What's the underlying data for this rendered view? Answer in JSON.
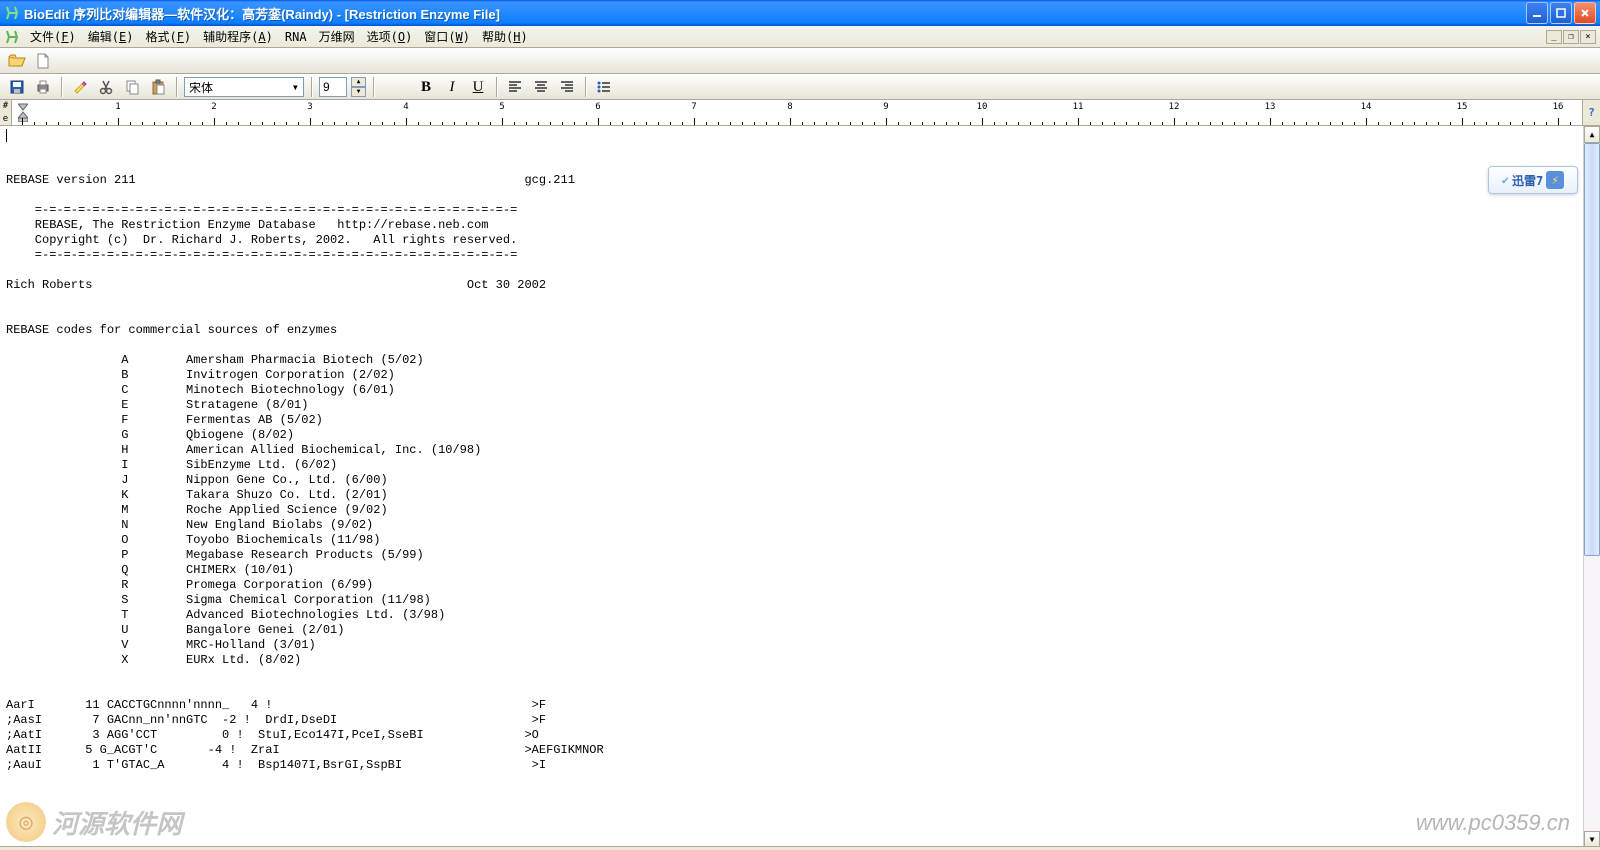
{
  "window": {
    "title": "BioEdit 序列比对编辑器—软件汉化：高芳銮(Raindy) - [Restriction Enzyme File]"
  },
  "menu": {
    "items": [
      {
        "label": "文件",
        "accel": "F"
      },
      {
        "label": "编辑",
        "accel": "E"
      },
      {
        "label": "格式",
        "accel": "F"
      },
      {
        "label": "辅助程序",
        "accel": "A"
      },
      {
        "label": "RNA",
        "accel": ""
      },
      {
        "label": "万维网",
        "accel": ""
      },
      {
        "label": "选项",
        "accel": "O"
      },
      {
        "label": "窗口",
        "accel": "W"
      },
      {
        "label": "帮助",
        "accel": "H"
      }
    ]
  },
  "toolbar2": {
    "font_name": "宋体",
    "font_size": "9"
  },
  "ruler": {
    "left_marks": [
      "#",
      "e"
    ]
  },
  "badge": {
    "label": "迅雷7"
  },
  "watermark": {
    "site": "河源软件网",
    "url": "www.pc0359.cn"
  },
  "doc": {
    "lines": [
      "",
      "REBASE version 211                                                      gcg.211",
      " ",
      "    =-=-=-=-=-=-=-=-=-=-=-=-=-=-=-=-=-=-=-=-=-=-=-=-=-=-=-=-=-=-=-=-=-=",
      "    REBASE, The Restriction Enzyme Database   http://rebase.neb.com",
      "    Copyright (c)  Dr. Richard J. Roberts, 2002.   All rights reserved.",
      "    =-=-=-=-=-=-=-=-=-=-=-=-=-=-=-=-=-=-=-=-=-=-=-=-=-=-=-=-=-=-=-=-=-=",
      " ",
      "Rich Roberts                                                    Oct 30 2002",
      " ",
      "",
      "REBASE codes for commercial sources of enzymes",
      "",
      "                A        Amersham Pharmacia Biotech (5/02)",
      "                B        Invitrogen Corporation (2/02)",
      "                C        Minotech Biotechnology (6/01)",
      "                E        Stratagene (8/01)",
      "                F        Fermentas AB (5/02)",
      "                G        Qbiogene (8/02)",
      "                H        American Allied Biochemical, Inc. (10/98)",
      "                I        SibEnzyme Ltd. (6/02)",
      "                J        Nippon Gene Co., Ltd. (6/00)",
      "                K        Takara Shuzo Co. Ltd. (2/01)",
      "                M        Roche Applied Science (9/02)",
      "                N        New England Biolabs (9/02)",
      "                O        Toyobo Biochemicals (11/98)",
      "                P        Megabase Research Products (5/99)",
      "                Q        CHIMERx (10/01)",
      "                R        Promega Corporation (6/99)",
      "                S        Sigma Chemical Corporation (11/98)",
      "                T        Advanced Biotechnologies Ltd. (3/98)",
      "                U        Bangalore Genei (2/01)",
      "                V        MRC-Holland (3/01)",
      "                X        EURx Ltd. (8/02)",
      "",
      "",
      "AarI       11 CACCTGCnnnn'nnnn_   4 !                                    >F",
      ";AasI       7 GACnn_nn'nnGTC  -2 !  DrdI,DseDI                           >F",
      ";AatI       3 AGG'CCT         0 !  StuI,Eco147I,PceI,SseBI              >O",
      "AatII      5 G_ACGT'C       -4 !  ZraI                                  >AEFGIKMNOR",
      ";AauI       1 T'GTAC_A        4 !  Bsp1407I,BsrGI,SspBI                  >I"
    ]
  }
}
